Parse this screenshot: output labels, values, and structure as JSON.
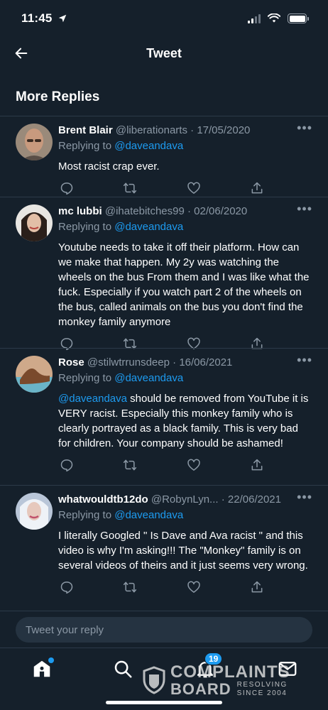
{
  "status_bar": {
    "time": "11:45"
  },
  "header": {
    "title": "Tweet"
  },
  "section": {
    "title": "More Replies"
  },
  "replying_label": "Replying to",
  "replies": [
    {
      "name": "Brent Blair",
      "handle": "@liberationarts",
      "date": "17/05/2020",
      "replying_to": "@daveandava",
      "text": "Most racist crap ever."
    },
    {
      "name": "mc lubbi",
      "handle": "@ihatebitches99",
      "date": "02/06/2020",
      "replying_to": "@daveandava",
      "text": "Youtube needs to take it off their platform. How can we make that happen. My 2y was watching the wheels on the bus From them and I was like what the fuck. Especially if you watch part 2 of the wheels on the bus, called animals on the bus you don't find the monkey family anymore"
    },
    {
      "name": "Rose",
      "handle": "@stilwtrrunsdeep",
      "date": "16/06/2021",
      "replying_to": "@daveandava",
      "text_mention": "@daveandava",
      "text": " should be removed from YouTube it is VERY racist. Especially this monkey family who is clearly portrayed as a black family. This is very bad for children. Your company should be ashamed!"
    },
    {
      "name": "whatwouldtb12do",
      "handle": "@RobynLyn...",
      "date": "22/06/2021",
      "replying_to": "@daveandava",
      "text": "I literally Googled \" Is Dave and Ava racist \" and this video is why I'm asking!!! The \"Monkey\" family is on several videos of theirs and it just seems very wrong."
    }
  ],
  "reply_box": {
    "placeholder": "Tweet your reply"
  },
  "tabbar": {
    "notifications_badge": "19"
  },
  "watermark": {
    "line1": "COMPLAINTS",
    "line2": "BOARD",
    "tag1": "RESOLVING",
    "tag2": "SINCE 2004"
  },
  "colors": {
    "background": "#15202b",
    "accent": "#1d9bf0",
    "muted": "#8b98a5",
    "divider": "#2c3a49"
  },
  "icons": [
    "back-arrow-icon",
    "more-icon",
    "reply-icon",
    "retweet-icon",
    "like-icon",
    "share-icon",
    "home-icon",
    "search-icon",
    "notifications-icon",
    "messages-icon",
    "location-arrow-icon",
    "signal-icon",
    "wifi-icon",
    "battery-icon"
  ]
}
